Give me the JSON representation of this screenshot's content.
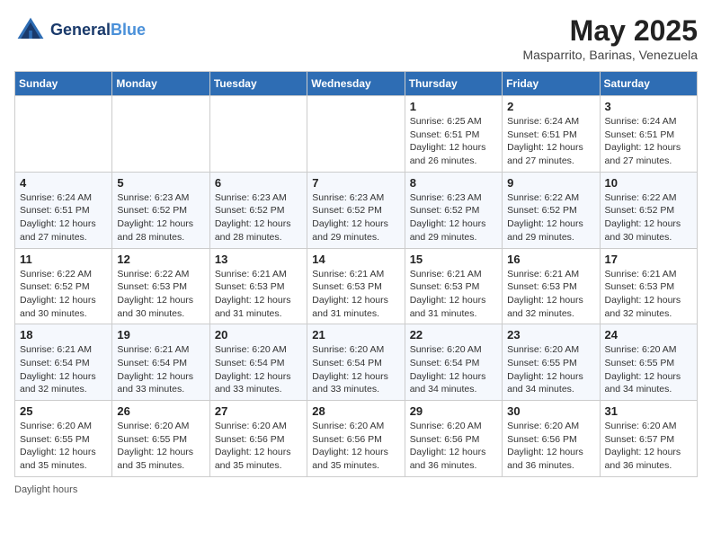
{
  "header": {
    "logo_line1": "General",
    "logo_line2": "Blue",
    "month_title": "May 2025",
    "location": "Masparrito, Barinas, Venezuela"
  },
  "footer": {
    "label": "Daylight hours"
  },
  "days_of_week": [
    "Sunday",
    "Monday",
    "Tuesday",
    "Wednesday",
    "Thursday",
    "Friday",
    "Saturday"
  ],
  "weeks": [
    [
      {
        "day": "",
        "info": ""
      },
      {
        "day": "",
        "info": ""
      },
      {
        "day": "",
        "info": ""
      },
      {
        "day": "",
        "info": ""
      },
      {
        "day": "1",
        "info": "Sunrise: 6:25 AM\nSunset: 6:51 PM\nDaylight: 12 hours\nand 26 minutes."
      },
      {
        "day": "2",
        "info": "Sunrise: 6:24 AM\nSunset: 6:51 PM\nDaylight: 12 hours\nand 27 minutes."
      },
      {
        "day": "3",
        "info": "Sunrise: 6:24 AM\nSunset: 6:51 PM\nDaylight: 12 hours\nand 27 minutes."
      }
    ],
    [
      {
        "day": "4",
        "info": "Sunrise: 6:24 AM\nSunset: 6:51 PM\nDaylight: 12 hours\nand 27 minutes."
      },
      {
        "day": "5",
        "info": "Sunrise: 6:23 AM\nSunset: 6:52 PM\nDaylight: 12 hours\nand 28 minutes."
      },
      {
        "day": "6",
        "info": "Sunrise: 6:23 AM\nSunset: 6:52 PM\nDaylight: 12 hours\nand 28 minutes."
      },
      {
        "day": "7",
        "info": "Sunrise: 6:23 AM\nSunset: 6:52 PM\nDaylight: 12 hours\nand 29 minutes."
      },
      {
        "day": "8",
        "info": "Sunrise: 6:23 AM\nSunset: 6:52 PM\nDaylight: 12 hours\nand 29 minutes."
      },
      {
        "day": "9",
        "info": "Sunrise: 6:22 AM\nSunset: 6:52 PM\nDaylight: 12 hours\nand 29 minutes."
      },
      {
        "day": "10",
        "info": "Sunrise: 6:22 AM\nSunset: 6:52 PM\nDaylight: 12 hours\nand 30 minutes."
      }
    ],
    [
      {
        "day": "11",
        "info": "Sunrise: 6:22 AM\nSunset: 6:52 PM\nDaylight: 12 hours\nand 30 minutes."
      },
      {
        "day": "12",
        "info": "Sunrise: 6:22 AM\nSunset: 6:53 PM\nDaylight: 12 hours\nand 30 minutes."
      },
      {
        "day": "13",
        "info": "Sunrise: 6:21 AM\nSunset: 6:53 PM\nDaylight: 12 hours\nand 31 minutes."
      },
      {
        "day": "14",
        "info": "Sunrise: 6:21 AM\nSunset: 6:53 PM\nDaylight: 12 hours\nand 31 minutes."
      },
      {
        "day": "15",
        "info": "Sunrise: 6:21 AM\nSunset: 6:53 PM\nDaylight: 12 hours\nand 31 minutes."
      },
      {
        "day": "16",
        "info": "Sunrise: 6:21 AM\nSunset: 6:53 PM\nDaylight: 12 hours\nand 32 minutes."
      },
      {
        "day": "17",
        "info": "Sunrise: 6:21 AM\nSunset: 6:53 PM\nDaylight: 12 hours\nand 32 minutes."
      }
    ],
    [
      {
        "day": "18",
        "info": "Sunrise: 6:21 AM\nSunset: 6:54 PM\nDaylight: 12 hours\nand 32 minutes."
      },
      {
        "day": "19",
        "info": "Sunrise: 6:21 AM\nSunset: 6:54 PM\nDaylight: 12 hours\nand 33 minutes."
      },
      {
        "day": "20",
        "info": "Sunrise: 6:20 AM\nSunset: 6:54 PM\nDaylight: 12 hours\nand 33 minutes."
      },
      {
        "day": "21",
        "info": "Sunrise: 6:20 AM\nSunset: 6:54 PM\nDaylight: 12 hours\nand 33 minutes."
      },
      {
        "day": "22",
        "info": "Sunrise: 6:20 AM\nSunset: 6:54 PM\nDaylight: 12 hours\nand 34 minutes."
      },
      {
        "day": "23",
        "info": "Sunrise: 6:20 AM\nSunset: 6:55 PM\nDaylight: 12 hours\nand 34 minutes."
      },
      {
        "day": "24",
        "info": "Sunrise: 6:20 AM\nSunset: 6:55 PM\nDaylight: 12 hours\nand 34 minutes."
      }
    ],
    [
      {
        "day": "25",
        "info": "Sunrise: 6:20 AM\nSunset: 6:55 PM\nDaylight: 12 hours\nand 35 minutes."
      },
      {
        "day": "26",
        "info": "Sunrise: 6:20 AM\nSunset: 6:55 PM\nDaylight: 12 hours\nand 35 minutes."
      },
      {
        "day": "27",
        "info": "Sunrise: 6:20 AM\nSunset: 6:56 PM\nDaylight: 12 hours\nand 35 minutes."
      },
      {
        "day": "28",
        "info": "Sunrise: 6:20 AM\nSunset: 6:56 PM\nDaylight: 12 hours\nand 35 minutes."
      },
      {
        "day": "29",
        "info": "Sunrise: 6:20 AM\nSunset: 6:56 PM\nDaylight: 12 hours\nand 36 minutes."
      },
      {
        "day": "30",
        "info": "Sunrise: 6:20 AM\nSunset: 6:56 PM\nDaylight: 12 hours\nand 36 minutes."
      },
      {
        "day": "31",
        "info": "Sunrise: 6:20 AM\nSunset: 6:57 PM\nDaylight: 12 hours\nand 36 minutes."
      }
    ]
  ]
}
